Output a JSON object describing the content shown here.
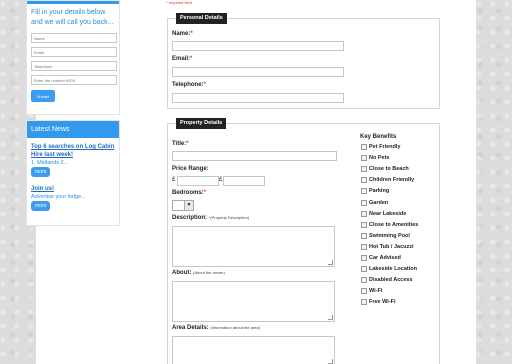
{
  "sidebar": {
    "callback": {
      "intro": "Fill in your details below and we will call you back...",
      "fields": [
        {
          "placeholder": "Name"
        },
        {
          "placeholder": "Email"
        },
        {
          "placeholder": "Telephone"
        },
        {
          "placeholder": "Enter the number 6929"
        }
      ],
      "submit_label": "Submit"
    },
    "news": {
      "heading": "Latest News",
      "items": [
        {
          "title": "Top 6 searches on Log Cabin Hire last week!",
          "meta": "1. Midlands 2...",
          "more_label": "more"
        },
        {
          "title": "Join us!",
          "meta": "Advertise your lodge...",
          "more_label": "more"
        }
      ]
    }
  },
  "required_note": "* required field",
  "personal": {
    "legend": "Personal Details",
    "name_label": "Name:",
    "email_label": "Email:",
    "telephone_label": "Telephone:",
    "req_mark": "*"
  },
  "property": {
    "legend": "Property Details",
    "title_label": "Title:",
    "price_label": "Price Range:",
    "currency_symbol": "£",
    "bedrooms_label": "Bedrooms:",
    "description_label": "Description:",
    "description_note": "*(Property Description)",
    "about_label": "About:",
    "about_note": "(About the owner)",
    "area_label": "Area Details:",
    "area_note": "(Information about the area)",
    "req_mark": "*"
  },
  "benefits": {
    "title": "Key Benefits",
    "items": [
      "Pet Friendly",
      "No Pets",
      "Close to Beach",
      "Children Friendly",
      "Parking",
      "Garden",
      "Near Lakeside",
      "Close to Amenities",
      "Swimming Pool",
      "Hot Tub / Jacuzzi",
      "Car Advised",
      "Lakeside Location",
      "Disabled Access",
      "Wi-Fi",
      "Free Wi-Fi"
    ]
  }
}
